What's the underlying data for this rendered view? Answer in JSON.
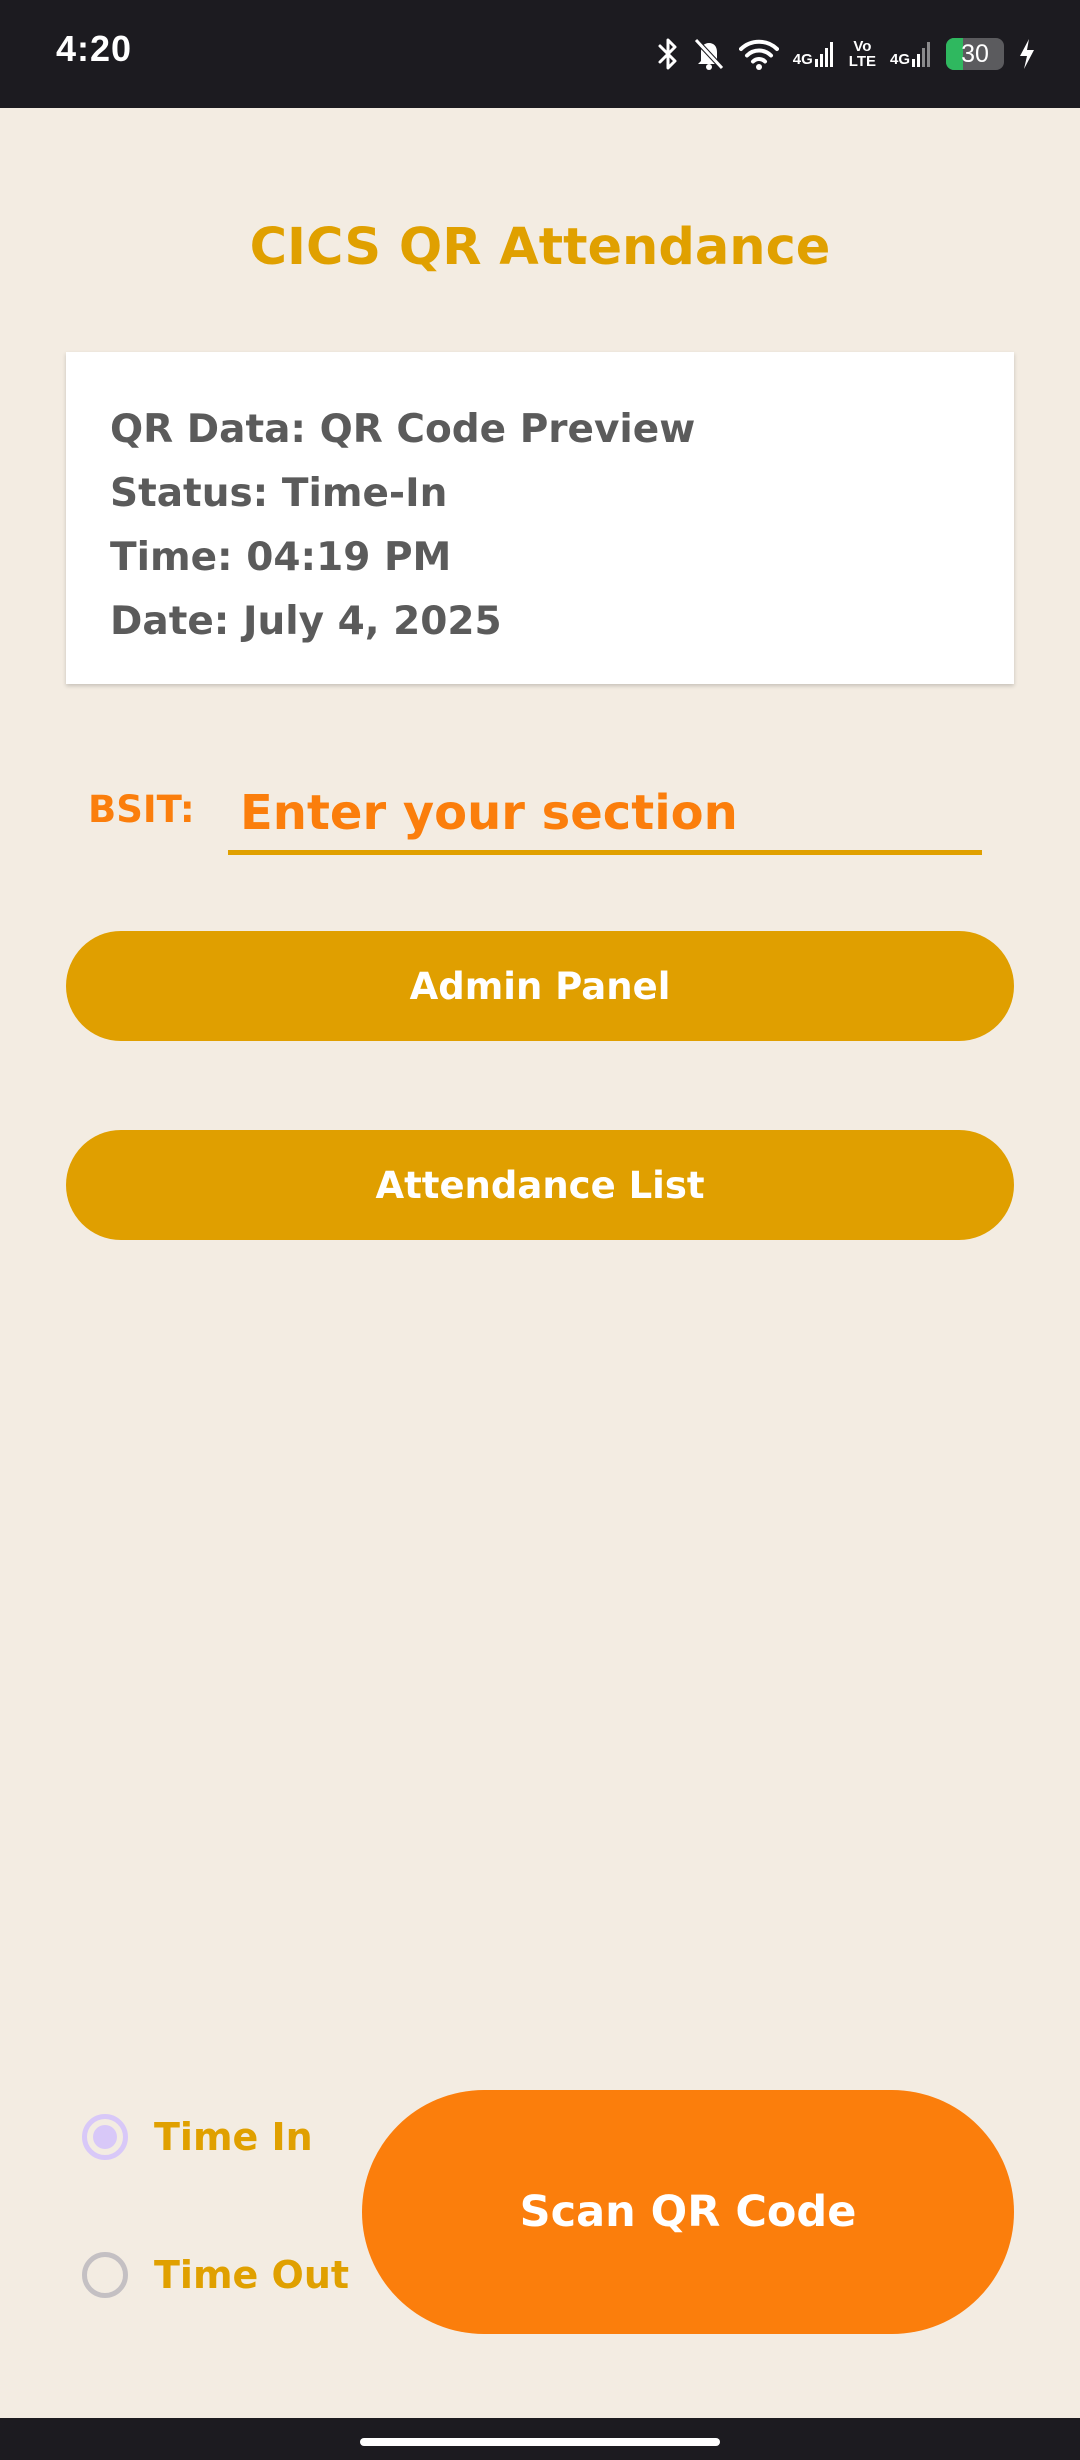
{
  "status_bar": {
    "time": "4:20",
    "network_1": "4G",
    "volte_top": "Vo",
    "volte_bottom": "LTE",
    "network_2": "4G",
    "battery_level": "30",
    "battery_fraction": 0.3,
    "icons": [
      "bluetooth-icon",
      "bell-off-icon",
      "wifi-icon",
      "signal-icon",
      "signal-icon",
      "battery-icon",
      "charging-bolt-icon"
    ]
  },
  "app": {
    "title": "CICS QR Attendance"
  },
  "info_card": {
    "qr_data": "QR Data: QR Code Preview",
    "status": "Status: Time-In",
    "time": "Time: 04:19 PM",
    "date": "Date: July 4, 2025"
  },
  "section": {
    "label": "BSIT:",
    "placeholder": "Enter your section",
    "value": ""
  },
  "buttons": {
    "admin_panel": "Admin Panel",
    "attendance_list": "Attendance List",
    "scan_qr": "Scan QR Code"
  },
  "mode": {
    "options": [
      "Time In",
      "Time Out"
    ],
    "time_in": "Time In",
    "time_out": "Time Out",
    "selected": "Time In"
  },
  "colors": {
    "background": "#f3ece2",
    "accent_gold": "#e0a000",
    "accent_orange": "#fb7e0c",
    "radio_selected": "#d8c8f8",
    "status_bar": "#1c1b20"
  }
}
